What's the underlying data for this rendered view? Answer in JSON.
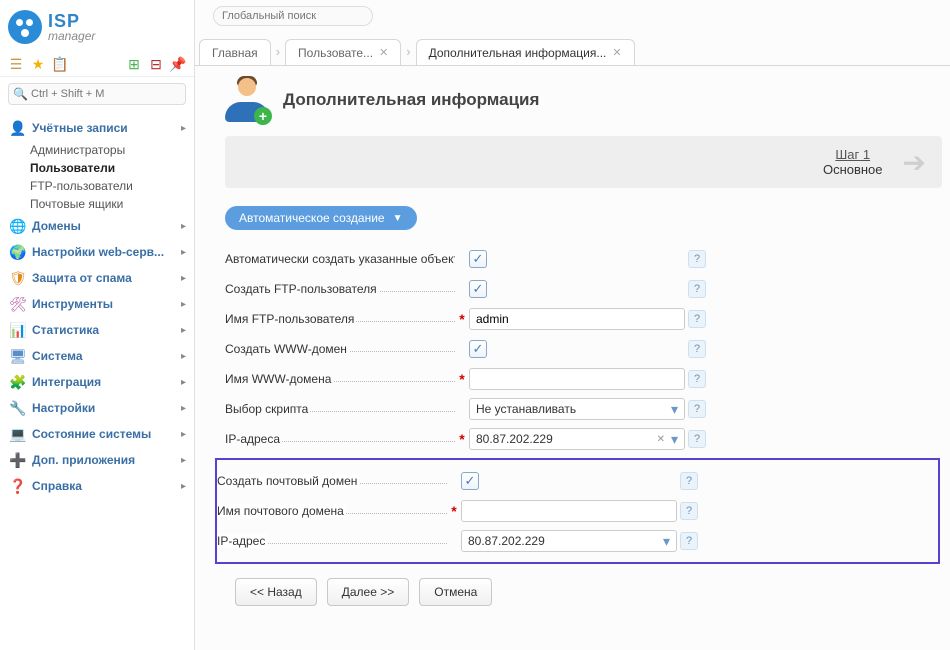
{
  "logo": {
    "line1": "ISP",
    "line2": "manager"
  },
  "sidebar": {
    "search_placeholder": "Ctrl + Shift + M",
    "groups": [
      {
        "icon": "👤",
        "color": "#d98b2e",
        "label": "Учётные записи",
        "expanded": true,
        "items": [
          "Администраторы",
          "Пользователи",
          "FTP-пользователи",
          "Почтовые ящики"
        ],
        "active_index": 1
      },
      {
        "icon": "🌐",
        "color": "#3a9c3a",
        "label": "Домены"
      },
      {
        "icon": "🌍",
        "color": "#2a8cd8",
        "label": "Настройки web-серв..."
      },
      {
        "icon": "🛡",
        "color": "#e08a1e",
        "label": "Защита от спама"
      },
      {
        "icon": "🛠",
        "color": "#b15a9c",
        "label": "Инструменты"
      },
      {
        "icon": "📊",
        "color": "#2a8cd8",
        "label": "Статистика"
      },
      {
        "icon": "🖥",
        "color": "#5a8ec7",
        "label": "Система"
      },
      {
        "icon": "🧩",
        "color": "#e06a1e",
        "label": "Интеграция"
      },
      {
        "icon": "🔧",
        "color": "#888",
        "label": "Настройки"
      },
      {
        "icon": "💻",
        "color": "#3b6fa5",
        "label": "Состояние системы"
      },
      {
        "icon": "➕",
        "color": "#3cb54a",
        "label": "Доп. приложения"
      },
      {
        "icon": "❓",
        "color": "#e8b100",
        "label": "Справка"
      }
    ]
  },
  "global_search_placeholder": "Глобальный поиск",
  "tabs": [
    {
      "label": "Главная",
      "closable": false
    },
    {
      "label": "Пользовате...",
      "closable": true
    },
    {
      "label": "Дополнительная информация...",
      "closable": true,
      "active": true
    }
  ],
  "page": {
    "title": "Дополнительная информация",
    "step_num": "Шаг 1",
    "step_name": "Основное",
    "section_header": "Автоматическое создание",
    "rows": {
      "auto_create": {
        "label": "Автоматически создать указанные объекты",
        "checked": true
      },
      "ftp_create": {
        "label": "Создать FTP-пользователя",
        "checked": true
      },
      "ftp_name": {
        "label": "Имя FTP-пользователя",
        "required": true,
        "value": "admin"
      },
      "www_create": {
        "label": "Создать WWW-домен",
        "checked": true
      },
      "www_name": {
        "label": "Имя WWW-домена",
        "required": true,
        "value": ""
      },
      "script": {
        "label": "Выбор скрипта",
        "value": "Не устанавливать"
      },
      "ip_addrs": {
        "label": "IP-адреса",
        "required": true,
        "value": "80.87.202.229",
        "deletable": true
      },
      "mail_create": {
        "label": "Создать почтовый домен",
        "checked": true
      },
      "mail_name": {
        "label": "Имя почтового домена",
        "required": true,
        "value": ""
      },
      "mail_ip": {
        "label": "IP-адрес",
        "value": "80.87.202.229"
      }
    },
    "buttons": {
      "back": "<< Назад",
      "next": "Далее >>",
      "cancel": "Отмена"
    }
  }
}
